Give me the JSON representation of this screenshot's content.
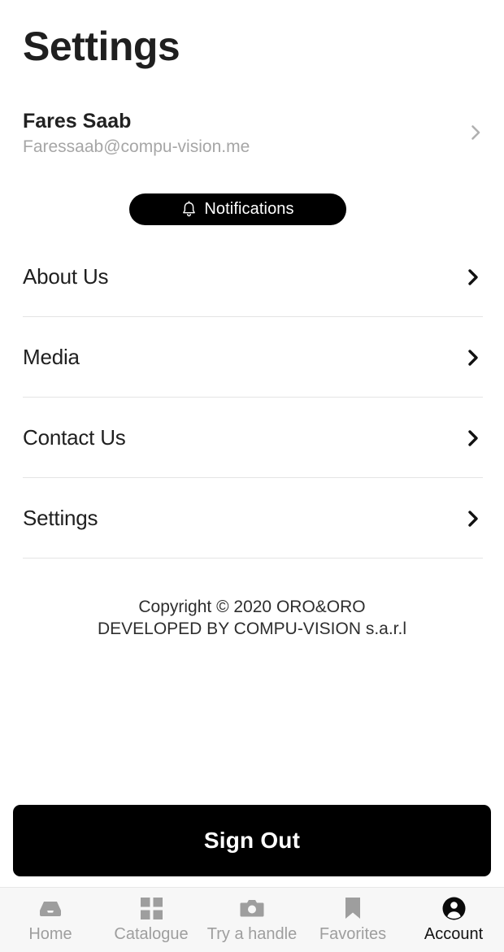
{
  "header": {
    "title": "Settings"
  },
  "profile": {
    "name": "Fares Saab",
    "email": "Faressaab@compu-vision.me",
    "chevron_icon": "chevron-right-icon"
  },
  "notifications": {
    "label": "Notifications",
    "icon": "bell-icon",
    "background_color": "#000000",
    "text_color": "#ffffff"
  },
  "menu": {
    "items": [
      {
        "label": "About Us",
        "icon": "chevron-right-icon"
      },
      {
        "label": "Media",
        "icon": "chevron-right-icon"
      },
      {
        "label": "Contact Us",
        "icon": "chevron-right-icon"
      },
      {
        "label": "Settings",
        "icon": "chevron-right-icon"
      }
    ]
  },
  "footer": {
    "copyright_line1": "Copyright © 2020 ORO&ORO",
    "copyright_line2": "DEVELOPED BY COMPU-VISION s.a.r.l"
  },
  "signout": {
    "label": "Sign Out",
    "background_color": "#000000",
    "text_color": "#ffffff"
  },
  "bottom_nav": {
    "active_index": 4,
    "active_color": "#141414",
    "inactive_color": "#9e9e9e",
    "items": [
      {
        "label": "Home",
        "icon": "inbox-tray-icon"
      },
      {
        "label": "Catalogue",
        "icon": "grid-icon"
      },
      {
        "label": "Try a handle",
        "icon": "camera-icon"
      },
      {
        "label": "Favorites",
        "icon": "bookmark-icon"
      },
      {
        "label": "Account",
        "icon": "account-circle-icon"
      }
    ]
  }
}
